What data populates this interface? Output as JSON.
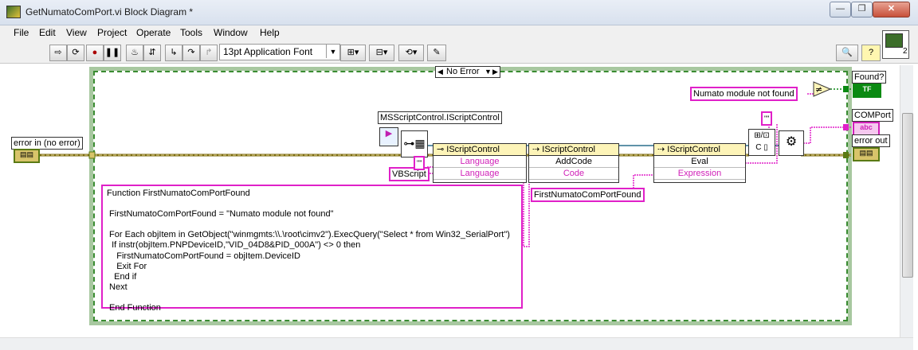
{
  "window": {
    "title": "GetNumatoComPort.vi Block Diagram *",
    "minimize": "—",
    "restore": "❐",
    "close": "✕"
  },
  "menu": [
    "File",
    "Edit",
    "View",
    "Project",
    "Operate",
    "Tools",
    "Window",
    "Help"
  ],
  "toolbar": {
    "font": "13pt Application Font"
  },
  "connector_pane_number": "2",
  "case_selector": "No Error",
  "labels": {
    "mscript": "MSScriptControl.IScriptControl",
    "vbscript": "VBScript",
    "not_found": "Numato module not found",
    "found": "Found?",
    "comport": "COMPort",
    "error_out": "error out",
    "error_in": "error in (no error)",
    "func_name": "FirstNumatoComPortFound",
    "empty_str": "\"\""
  },
  "nodes": {
    "n1": {
      "header": "IScriptControl",
      "rows": [
        "Language",
        "Language"
      ]
    },
    "n2": {
      "header": "IScriptControl",
      "rows": [
        "AddCode",
        "Code"
      ]
    },
    "n3": {
      "header": "IScriptControl",
      "rows": [
        "Eval",
        "Expression"
      ]
    }
  },
  "terminals": {
    "tf": "TF",
    "abc": "abc"
  },
  "script_text": "Function FirstNumatoComPortFound\n\n FirstNumatoComPortFound = \"Numato module not found\"\n\n For Each objItem in GetObject(\"winmgmts:\\\\.\\root\\cimv2\").ExecQuery(\"Select * from Win32_SerialPort\")\n  If instr(objItem.PNPDeviceID,\"VID_04D8&PID_000A\") <> 0 then\n    FirstNumatoComPortFound = objItem.DeviceID\n    Exit For\n   End if\n Next\n\n End Function",
  "colors": {
    "string_wire": "#e020c8",
    "error_wire": "#7a6a10",
    "case_border": "#3a8c32"
  }
}
